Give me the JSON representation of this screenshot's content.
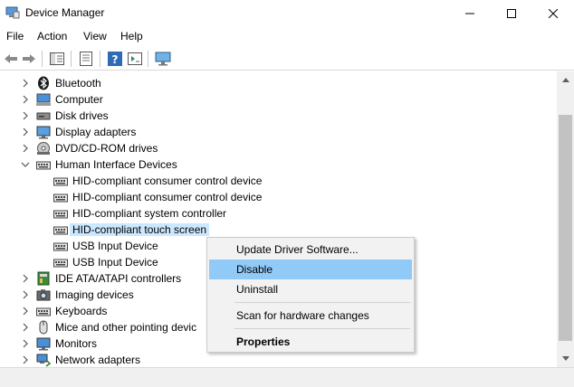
{
  "window": {
    "title": "Device Manager",
    "icon": "device-manager-icon",
    "controls": [
      "minimize-icon",
      "maximize-icon",
      "close-icon"
    ]
  },
  "menu": {
    "file": "File",
    "action": "Action",
    "view": "View",
    "help": "Help"
  },
  "toolbar": {
    "buttons": [
      "back-icon",
      "forward-icon",
      "show-hide-tree-icon",
      "properties-icon",
      "help-icon",
      "run-action-icon",
      "scan-monitor-icon"
    ]
  },
  "tree": {
    "items": [
      {
        "label": "Bluetooth",
        "icon": "bluetooth-icon",
        "expander": "collapsed"
      },
      {
        "label": "Computer",
        "icon": "computer-icon",
        "expander": "collapsed"
      },
      {
        "label": "Disk drives",
        "icon": "disk-drive-icon",
        "expander": "collapsed"
      },
      {
        "label": "Display adapters",
        "icon": "display-adapter-icon",
        "expander": "collapsed"
      },
      {
        "label": "DVD/CD-ROM drives",
        "icon": "dvd-drive-icon",
        "expander": "collapsed"
      },
      {
        "label": "Human Interface Devices",
        "icon": "hid-icon",
        "expander": "expanded"
      },
      {
        "label": "HID-compliant consumer control device",
        "icon": "hid-device-icon",
        "child": true
      },
      {
        "label": "HID-compliant consumer control device",
        "icon": "hid-device-icon",
        "child": true
      },
      {
        "label": "HID-compliant system controller",
        "icon": "hid-device-icon",
        "child": true
      },
      {
        "label": "HID-compliant touch screen",
        "icon": "hid-device-icon",
        "child": true,
        "selected": true
      },
      {
        "label": "USB Input Device",
        "icon": "hid-device-icon",
        "child": true
      },
      {
        "label": "USB Input Device",
        "icon": "hid-device-icon",
        "child": true
      },
      {
        "label": "IDE ATA/ATAPI controllers",
        "icon": "ide-controller-icon",
        "expander": "collapsed"
      },
      {
        "label": "Imaging devices",
        "icon": "camera-icon",
        "expander": "collapsed"
      },
      {
        "label": "Keyboards",
        "icon": "keyboard-icon",
        "expander": "collapsed"
      },
      {
        "label": "Mice and other pointing devic",
        "icon": "mouse-icon",
        "expander": "collapsed"
      },
      {
        "label": "Monitors",
        "icon": "monitor-icon",
        "expander": "collapsed"
      },
      {
        "label": "Network adapters",
        "icon": "network-adapter-icon",
        "expander": "collapsed"
      }
    ]
  },
  "context_menu": {
    "items": [
      {
        "label": "Update Driver Software...",
        "highlighted": false
      },
      {
        "label": "Disable",
        "highlighted": true
      },
      {
        "label": "Uninstall",
        "highlighted": false
      },
      {
        "label": "Scan for hardware changes",
        "highlighted": false
      },
      {
        "label": "Properties",
        "bold": true
      }
    ]
  },
  "colors": {
    "selection": "#cce8ff",
    "menu_highlight": "#91c9f7",
    "menu_background": "#f2f2f2",
    "help_icon": "#2f6bb5"
  }
}
